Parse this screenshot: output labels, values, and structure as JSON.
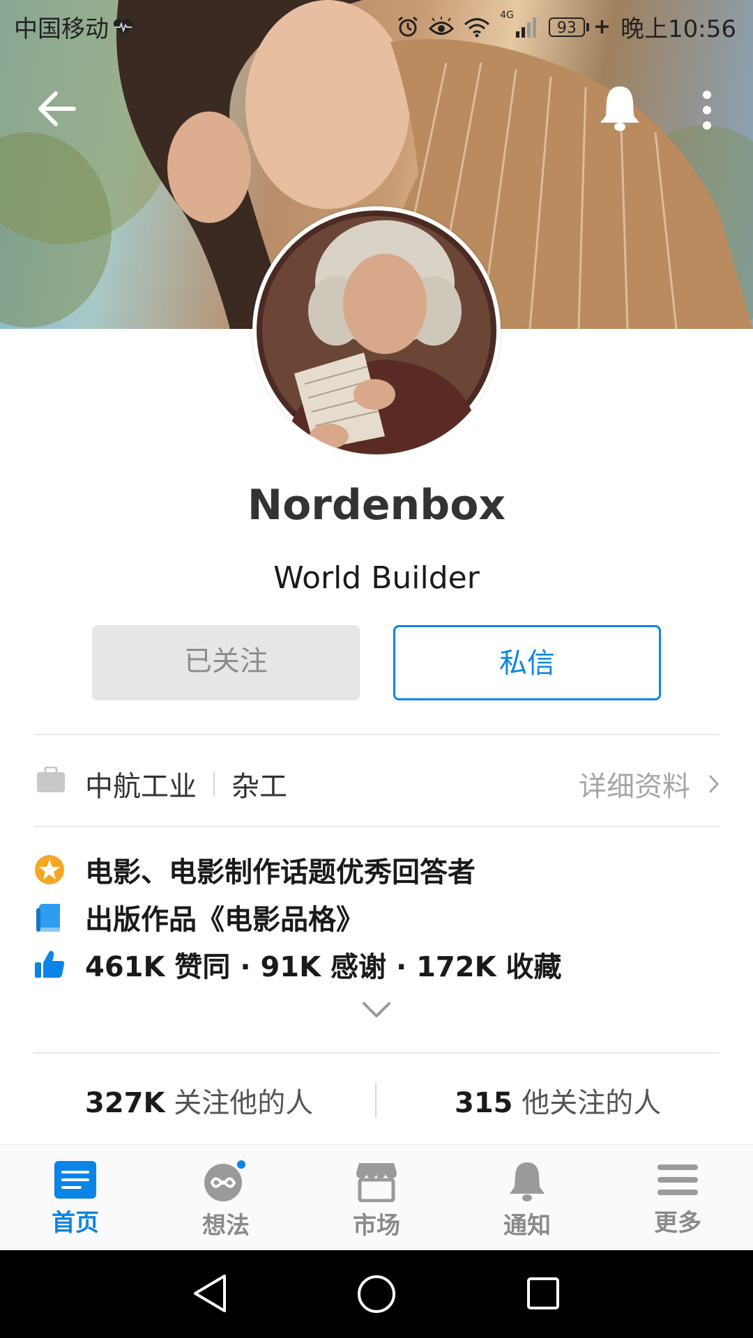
{
  "status_bar": {
    "carrier": "中国移动",
    "network": "4G",
    "battery": "93",
    "time": "晚上10:56"
  },
  "profile": {
    "name": "Nordenbox",
    "headline": "World Builder"
  },
  "actions": {
    "followed_label": "已关注",
    "message_label": "私信"
  },
  "company": {
    "employer": "中航工业",
    "position": "杂工",
    "details_label": "详细资料"
  },
  "achievements": [
    {
      "icon": "star-badge-icon",
      "text": "电影、电影制作话题优秀回答者"
    },
    {
      "icon": "book-icon",
      "text": "出版作品《电影品格》"
    },
    {
      "icon": "thumbs-up-icon",
      "text": "461K 赞同 · 91K 感谢 · 172K 收藏"
    }
  ],
  "followers": {
    "followers_count": "327K",
    "followers_label": "关注他的人",
    "following_count": "315",
    "following_label": "他关注的人"
  },
  "bottom_nav": [
    {
      "label": "首页",
      "icon": "home-feed-icon",
      "active": true
    },
    {
      "label": "想法",
      "icon": "ideas-icon",
      "active": false
    },
    {
      "label": "市场",
      "icon": "market-icon",
      "active": false
    },
    {
      "label": "通知",
      "icon": "notification-bell-icon",
      "active": false
    },
    {
      "label": "更多",
      "icon": "menu-icon",
      "active": false
    }
  ],
  "colors": {
    "accent": "#0a84e6",
    "badge_orange": "#f5a623",
    "muted_text": "#a6a6a6"
  }
}
